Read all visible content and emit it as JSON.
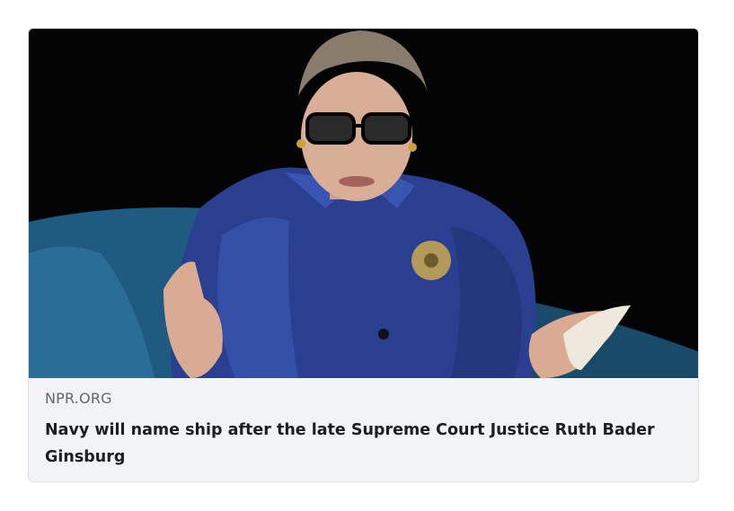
{
  "link_card": {
    "source_domain": "NPR.ORG",
    "headline": "Navy will name ship after the late Supreme Court Justice Ruth Bader Ginsburg",
    "image_subject": "photo-justice-ginsburg-seated"
  },
  "colors": {
    "image_background": "#040405",
    "chair": "#1f5b80",
    "jacket": "#2a3f8f",
    "caption_background": "#f2f3f5",
    "domain_text": "#606770",
    "headline_text": "#1c1e21"
  }
}
